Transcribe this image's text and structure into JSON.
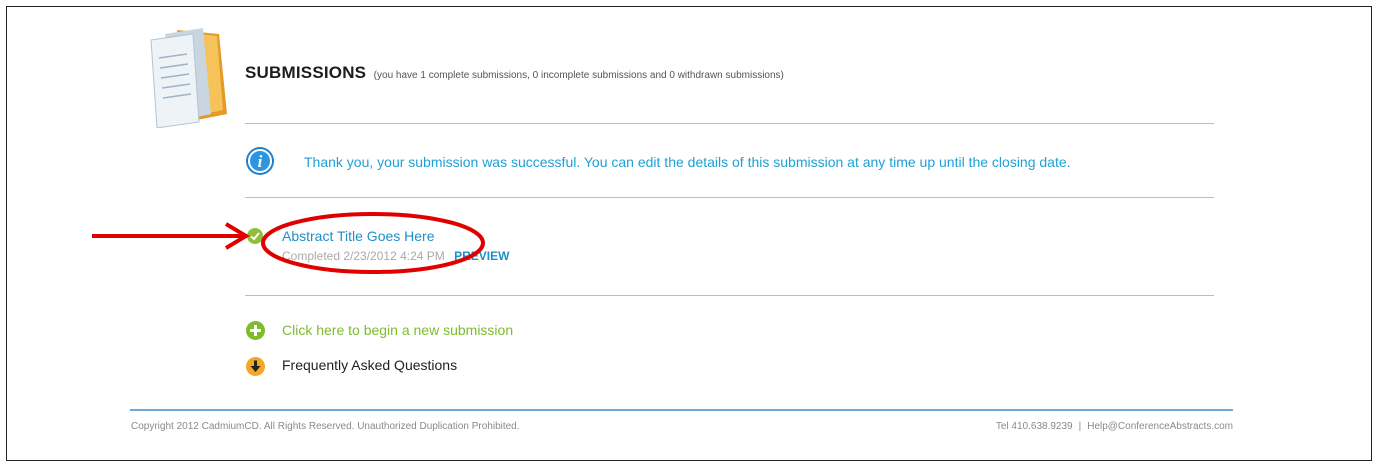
{
  "header": {
    "title": "SUBMISSIONS",
    "subtitle": "(you have 1 complete submissions, 0 incomplete submissions and 0 withdrawn submissions)"
  },
  "info": {
    "message": "Thank you, your submission was successful. You can edit the details of this submission at any time up until the closing date.",
    "icon": "info-icon"
  },
  "submissions": [
    {
      "title": "Abstract Title Goes Here",
      "status": "Completed 2/23/2012 4:24 PM",
      "action": "PREVIEW",
      "icon": "check-icon"
    }
  ],
  "actions": {
    "new_submission": "Click here to begin a new submission",
    "faq": "Frequently Asked Questions"
  },
  "footer": {
    "copyright": "Copyright 2012 CadmiumCD. All Rights Reserved. Unauthorized Duplication Prohibited.",
    "phone": "Tel 410.638.9239",
    "separator": "|",
    "email": "Help@ConferenceAbstracts.com"
  },
  "colors": {
    "accent_blue": "#1ea1d6",
    "link_blue": "#1e90c7",
    "green": "#7cbd2a",
    "annotation_red": "#e00000"
  }
}
